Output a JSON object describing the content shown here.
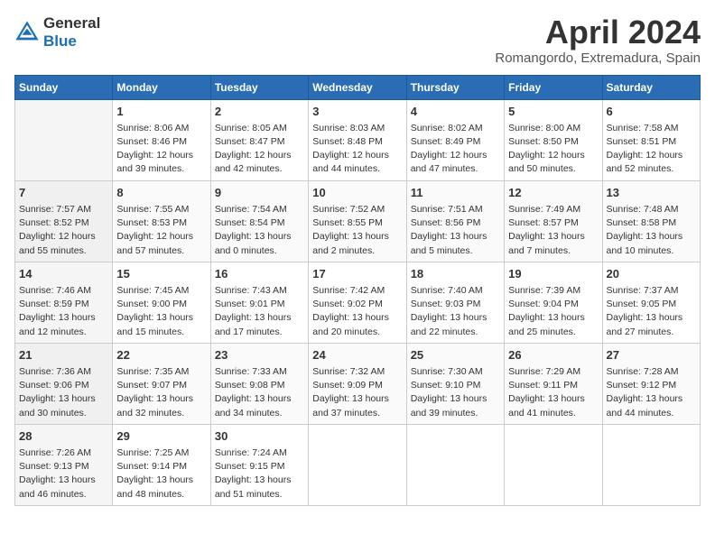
{
  "header": {
    "logo": {
      "text_general": "General",
      "text_blue": "Blue",
      "icon_label": "general-blue-logo-icon"
    },
    "title": "April 2024",
    "subtitle": "Romangordo, Extremadura, Spain"
  },
  "calendar": {
    "days_of_week": [
      "Sunday",
      "Monday",
      "Tuesday",
      "Wednesday",
      "Thursday",
      "Friday",
      "Saturday"
    ],
    "weeks": [
      [
        {
          "day": "",
          "sunrise": "",
          "sunset": "",
          "daylight": ""
        },
        {
          "day": "1",
          "sunrise": "Sunrise: 8:06 AM",
          "sunset": "Sunset: 8:46 PM",
          "daylight": "Daylight: 12 hours and 39 minutes."
        },
        {
          "day": "2",
          "sunrise": "Sunrise: 8:05 AM",
          "sunset": "Sunset: 8:47 PM",
          "daylight": "Daylight: 12 hours and 42 minutes."
        },
        {
          "day": "3",
          "sunrise": "Sunrise: 8:03 AM",
          "sunset": "Sunset: 8:48 PM",
          "daylight": "Daylight: 12 hours and 44 minutes."
        },
        {
          "day": "4",
          "sunrise": "Sunrise: 8:02 AM",
          "sunset": "Sunset: 8:49 PM",
          "daylight": "Daylight: 12 hours and 47 minutes."
        },
        {
          "day": "5",
          "sunrise": "Sunrise: 8:00 AM",
          "sunset": "Sunset: 8:50 PM",
          "daylight": "Daylight: 12 hours and 50 minutes."
        },
        {
          "day": "6",
          "sunrise": "Sunrise: 7:58 AM",
          "sunset": "Sunset: 8:51 PM",
          "daylight": "Daylight: 12 hours and 52 minutes."
        }
      ],
      [
        {
          "day": "7",
          "sunrise": "Sunrise: 7:57 AM",
          "sunset": "Sunset: 8:52 PM",
          "daylight": "Daylight: 12 hours and 55 minutes."
        },
        {
          "day": "8",
          "sunrise": "Sunrise: 7:55 AM",
          "sunset": "Sunset: 8:53 PM",
          "daylight": "Daylight: 12 hours and 57 minutes."
        },
        {
          "day": "9",
          "sunrise": "Sunrise: 7:54 AM",
          "sunset": "Sunset: 8:54 PM",
          "daylight": "Daylight: 13 hours and 0 minutes."
        },
        {
          "day": "10",
          "sunrise": "Sunrise: 7:52 AM",
          "sunset": "Sunset: 8:55 PM",
          "daylight": "Daylight: 13 hours and 2 minutes."
        },
        {
          "day": "11",
          "sunrise": "Sunrise: 7:51 AM",
          "sunset": "Sunset: 8:56 PM",
          "daylight": "Daylight: 13 hours and 5 minutes."
        },
        {
          "day": "12",
          "sunrise": "Sunrise: 7:49 AM",
          "sunset": "Sunset: 8:57 PM",
          "daylight": "Daylight: 13 hours and 7 minutes."
        },
        {
          "day": "13",
          "sunrise": "Sunrise: 7:48 AM",
          "sunset": "Sunset: 8:58 PM",
          "daylight": "Daylight: 13 hours and 10 minutes."
        }
      ],
      [
        {
          "day": "14",
          "sunrise": "Sunrise: 7:46 AM",
          "sunset": "Sunset: 8:59 PM",
          "daylight": "Daylight: 13 hours and 12 minutes."
        },
        {
          "day": "15",
          "sunrise": "Sunrise: 7:45 AM",
          "sunset": "Sunset: 9:00 PM",
          "daylight": "Daylight: 13 hours and 15 minutes."
        },
        {
          "day": "16",
          "sunrise": "Sunrise: 7:43 AM",
          "sunset": "Sunset: 9:01 PM",
          "daylight": "Daylight: 13 hours and 17 minutes."
        },
        {
          "day": "17",
          "sunrise": "Sunrise: 7:42 AM",
          "sunset": "Sunset: 9:02 PM",
          "daylight": "Daylight: 13 hours and 20 minutes."
        },
        {
          "day": "18",
          "sunrise": "Sunrise: 7:40 AM",
          "sunset": "Sunset: 9:03 PM",
          "daylight": "Daylight: 13 hours and 22 minutes."
        },
        {
          "day": "19",
          "sunrise": "Sunrise: 7:39 AM",
          "sunset": "Sunset: 9:04 PM",
          "daylight": "Daylight: 13 hours and 25 minutes."
        },
        {
          "day": "20",
          "sunrise": "Sunrise: 7:37 AM",
          "sunset": "Sunset: 9:05 PM",
          "daylight": "Daylight: 13 hours and 27 minutes."
        }
      ],
      [
        {
          "day": "21",
          "sunrise": "Sunrise: 7:36 AM",
          "sunset": "Sunset: 9:06 PM",
          "daylight": "Daylight: 13 hours and 30 minutes."
        },
        {
          "day": "22",
          "sunrise": "Sunrise: 7:35 AM",
          "sunset": "Sunset: 9:07 PM",
          "daylight": "Daylight: 13 hours and 32 minutes."
        },
        {
          "day": "23",
          "sunrise": "Sunrise: 7:33 AM",
          "sunset": "Sunset: 9:08 PM",
          "daylight": "Daylight: 13 hours and 34 minutes."
        },
        {
          "day": "24",
          "sunrise": "Sunrise: 7:32 AM",
          "sunset": "Sunset: 9:09 PM",
          "daylight": "Daylight: 13 hours and 37 minutes."
        },
        {
          "day": "25",
          "sunrise": "Sunrise: 7:30 AM",
          "sunset": "Sunset: 9:10 PM",
          "daylight": "Daylight: 13 hours and 39 minutes."
        },
        {
          "day": "26",
          "sunrise": "Sunrise: 7:29 AM",
          "sunset": "Sunset: 9:11 PM",
          "daylight": "Daylight: 13 hours and 41 minutes."
        },
        {
          "day": "27",
          "sunrise": "Sunrise: 7:28 AM",
          "sunset": "Sunset: 9:12 PM",
          "daylight": "Daylight: 13 hours and 44 minutes."
        }
      ],
      [
        {
          "day": "28",
          "sunrise": "Sunrise: 7:26 AM",
          "sunset": "Sunset: 9:13 PM",
          "daylight": "Daylight: 13 hours and 46 minutes."
        },
        {
          "day": "29",
          "sunrise": "Sunrise: 7:25 AM",
          "sunset": "Sunset: 9:14 PM",
          "daylight": "Daylight: 13 hours and 48 minutes."
        },
        {
          "day": "30",
          "sunrise": "Sunrise: 7:24 AM",
          "sunset": "Sunset: 9:15 PM",
          "daylight": "Daylight: 13 hours and 51 minutes."
        },
        {
          "day": "",
          "sunrise": "",
          "sunset": "",
          "daylight": ""
        },
        {
          "day": "",
          "sunrise": "",
          "sunset": "",
          "daylight": ""
        },
        {
          "day": "",
          "sunrise": "",
          "sunset": "",
          "daylight": ""
        },
        {
          "day": "",
          "sunrise": "",
          "sunset": "",
          "daylight": ""
        }
      ]
    ]
  }
}
